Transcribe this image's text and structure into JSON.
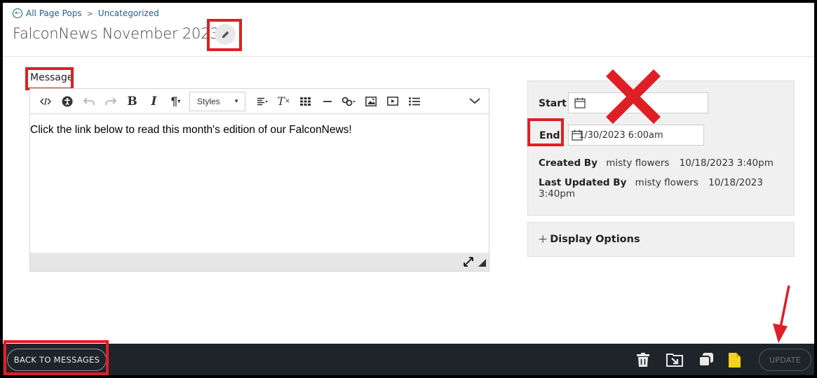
{
  "breadcrumb": {
    "back_label": "All Page Pops",
    "separator": ">",
    "current": "Uncategorized"
  },
  "title": "FalconNews November 2023",
  "editor": {
    "label": "Message",
    "styles_label": "Styles",
    "content": "Click the link below to read this month's edition of our FalconNews!"
  },
  "schedule": {
    "start_label": "Start",
    "start_value": "",
    "end_label": "End",
    "end_value": "1/30/2023 6:00am",
    "created_by_label": "Created By",
    "created_by_name": "misty flowers",
    "created_by_date": "10/18/2023 3:40pm",
    "updated_by_label": "Last Updated By",
    "updated_by_name": "misty flowers",
    "updated_by_date": "10/18/2023 3:40pm"
  },
  "display_options": {
    "plus": "+",
    "label": "Display Options"
  },
  "footer": {
    "back_label": "BACK TO MESSAGES",
    "update_label": "UPDATE"
  },
  "colors": {
    "annotation_red": "#e01e26",
    "footer_bg": "#1f2429",
    "link_blue": "#1e5f8a",
    "note_yellow": "#f5d31c"
  },
  "icons": {
    "breadcrumb_back": "circle-arrow-left-icon",
    "edit_title": "pencil-icon",
    "toolbar": [
      "code-view-icon",
      "accessibility-icon",
      "undo-icon",
      "redo-icon",
      "bold-icon",
      "italic-icon",
      "paragraph-icon",
      "align-icon",
      "clear-format-icon",
      "table-icon",
      "horizontal-line-icon",
      "link-icon",
      "image-icon",
      "video-icon",
      "list-icon",
      "collapse-chevron-icon"
    ],
    "footer": [
      "trash-icon",
      "move-icon",
      "duplicate-icon",
      "note-icon"
    ]
  }
}
